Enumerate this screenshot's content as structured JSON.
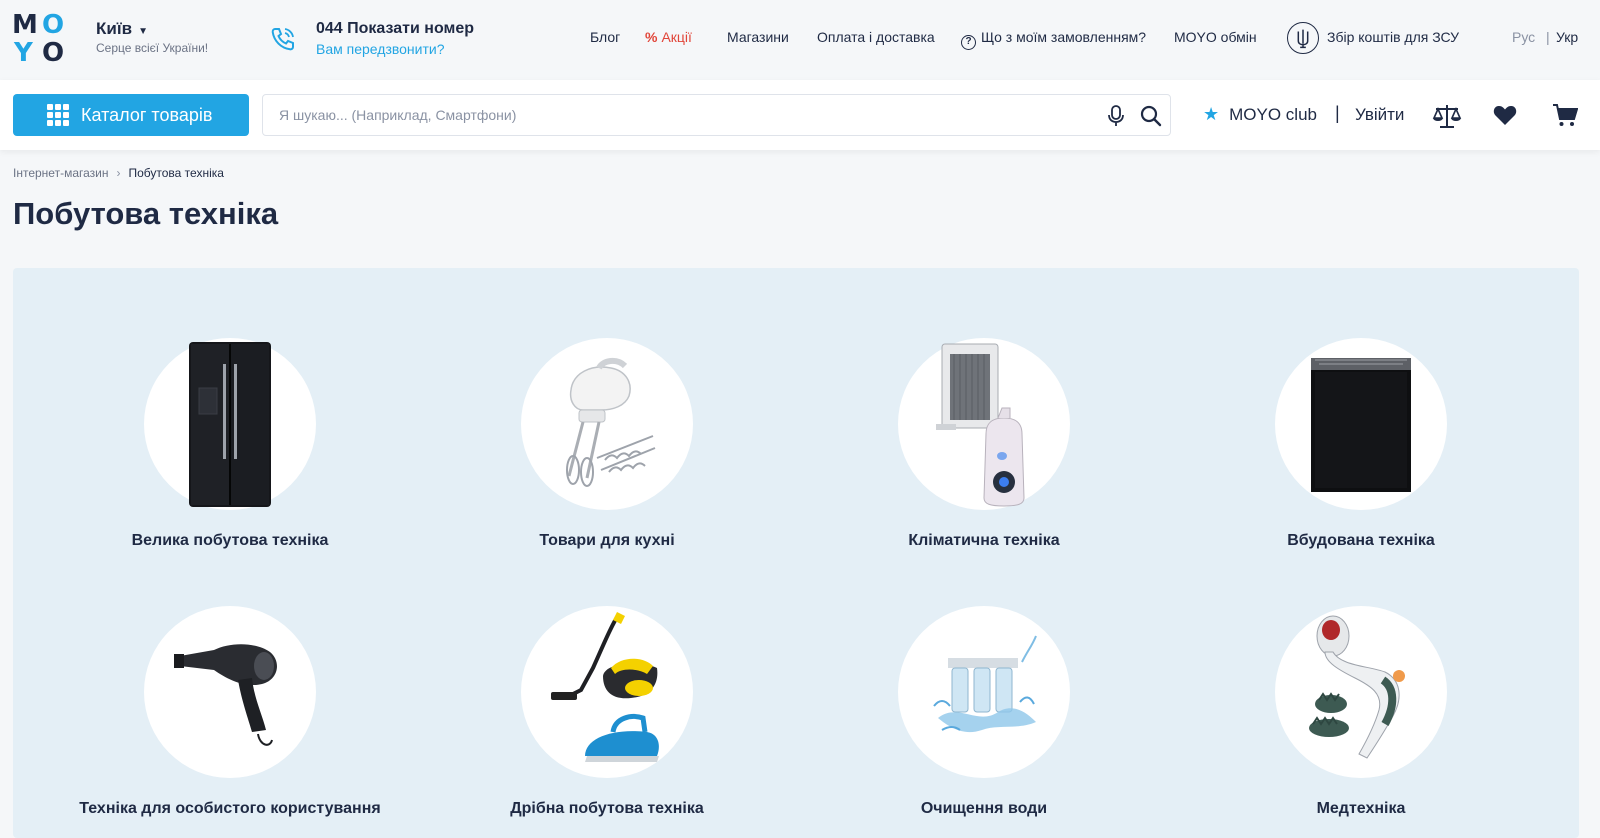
{
  "header": {
    "logo_letters": [
      "M",
      "O",
      "Y",
      "O"
    ],
    "city": "Київ",
    "city_subtitle": "Серце всієї України!",
    "phone_label": "044 Показати номер",
    "callback_label": "Вам передзвонити?",
    "nav": {
      "blog": "Блог",
      "sale_icon": "%",
      "sale": "Акції",
      "stores": "Магазини",
      "payment": "Оплата і доставка",
      "order_icon": "?",
      "order_status": "Що з моїм замовленням?",
      "exchange": "MOYO обмін",
      "fundraising": "Збір коштів для ЗСУ"
    },
    "lang": {
      "ru": "Рус",
      "sep": "|",
      "ua": "Укр"
    }
  },
  "search_row": {
    "catalog_label": "Каталог товарів",
    "search_placeholder": "Я шукаю... (Наприклад, Смартфони)",
    "club_star": "★",
    "club_label": "MOYO club",
    "divider": "|",
    "login_label": "Увійти"
  },
  "breadcrumb": {
    "home": "Інтернет-магазин",
    "sep": "›",
    "current": "Побутова техніка"
  },
  "page_title": "Побутова техніка",
  "categories": [
    {
      "label": "Велика побутова техніка",
      "icon": "refrigerator-icon"
    },
    {
      "label": "Товари для кухні",
      "icon": "hand-mixer-icon"
    },
    {
      "label": "Кліматична техніка",
      "icon": "heater-humidifier-icon"
    },
    {
      "label": "Вбудована техніка",
      "icon": "dishwasher-icon"
    },
    {
      "label": "Техніка для особистого користування",
      "icon": "hair-dryer-icon"
    },
    {
      "label": "Дрібна побутова техніка",
      "icon": "steam-cleaner-iron-icon"
    },
    {
      "label": "Очищення води",
      "icon": "water-filter-icon"
    },
    {
      "label": "Медтехніка",
      "icon": "massager-icon"
    }
  ],
  "colors": {
    "accent": "#22a5e3",
    "text": "#1f2a44",
    "sale": "#e1463a",
    "panel": "#e4eff6"
  }
}
